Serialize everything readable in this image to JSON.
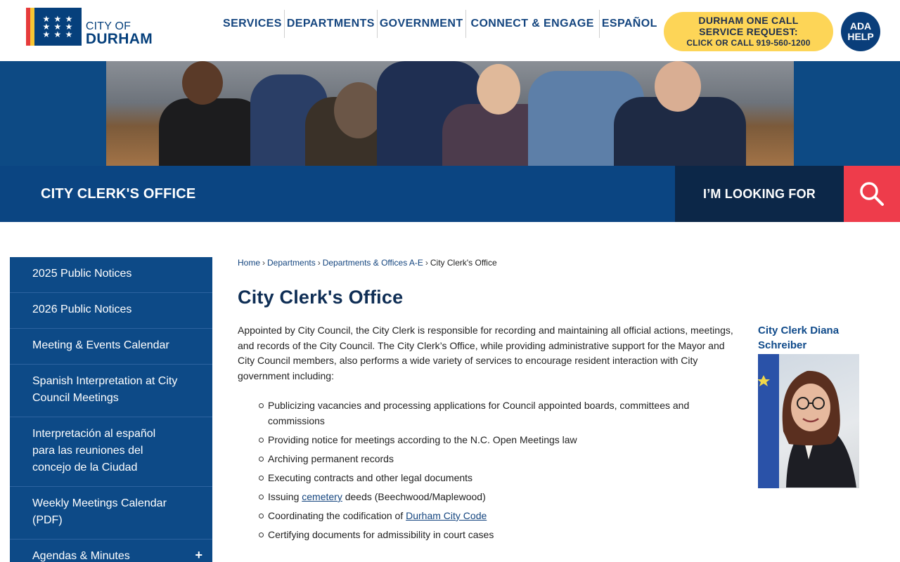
{
  "header": {
    "logo_line1": "CITY OF",
    "logo_line2": "DURHAM",
    "nav": [
      "SERVICES",
      "DEPARTMENTS",
      "GOVERNMENT",
      "CONNECT & ENGAGE",
      "ESPAÑOL"
    ],
    "call_line1": "DURHAM ONE CALL",
    "call_line2": "SERVICE REQUEST:",
    "call_line3": "CLICK OR CALL 919-560-1200",
    "ada_line1": "ADA",
    "ada_line2": "HELP"
  },
  "colors": {
    "brand_blue": "#0b4582",
    "dark_navy": "#0c2748",
    "search_red": "#ee3c4b",
    "call_yellow": "#fdd557",
    "logo_bar_red": "#e63b3b",
    "logo_bar_yellow": "#f7c633"
  },
  "dept_bar": {
    "title": "CITY CLERK'S OFFICE",
    "looking_for": "I’M LOOKING FOR",
    "search_icon": "search-icon"
  },
  "sidebar": {
    "items": [
      {
        "label": "2025 Public Notices"
      },
      {
        "label": "2026 Public Notices"
      },
      {
        "label": "Meeting & Events Calendar"
      },
      {
        "label": "Spanish Interpretation at City Council Meetings"
      },
      {
        "label": "Interpretación al español para las reuniones del concejo de la Ciudad"
      },
      {
        "label": "Weekly Meetings Calendar (PDF)"
      },
      {
        "label": "Agendas & Minutes",
        "expand": "+"
      }
    ]
  },
  "breadcrumb": [
    "Home",
    "Departments",
    "Departments & Offices A-E",
    "City Clerk's Office"
  ],
  "main": {
    "title": "City Clerk's Office",
    "intro": "Appointed by City Council, the City Clerk is responsible for recording and maintaining all official actions, meetings, and records of the City Council. The City Clerk’s Office, while providing administrative support for the Mayor and City Council members, also performs a wide variety of services to encourage resident interaction with City government including:",
    "bullets": [
      {
        "text": "Publicizing vacancies and processing applications for Council appointed boards, committees and commissions"
      },
      {
        "text": "Providing notice for meetings according to the N.C. Open Meetings law"
      },
      {
        "text": "Archiving permanent records"
      },
      {
        "text": "Executing contracts and other legal documents"
      },
      {
        "pre": "Issuing ",
        "link": "cemetery",
        "post": " deeds (Beechwood/Maplewood)"
      },
      {
        "pre": "Coordinating the codification of ",
        "link": "Durham City Code",
        "post": ""
      },
      {
        "text": "Certifying documents for admissibility in court cases"
      }
    ],
    "clerk_caption": "City Clerk Diana Schreiber"
  }
}
